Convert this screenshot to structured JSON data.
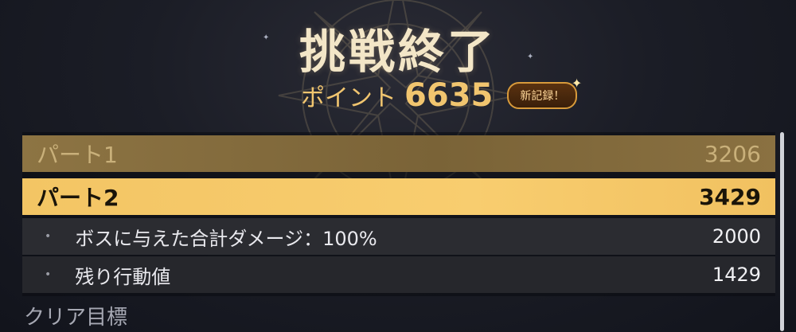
{
  "header": {
    "title": "挑戦終了",
    "points_label": "ポイント",
    "points_value": "6635",
    "new_record_badge": "新記録！"
  },
  "breakdown": {
    "part1": {
      "label": "パート1",
      "value": "3206"
    },
    "part2": {
      "label": "パート2",
      "value": "3429"
    },
    "sub_items": [
      {
        "bullet": "•",
        "label": "ボスに与えた合計ダメージ：100%",
        "value": "2000"
      },
      {
        "bullet": "•",
        "label": "残り行動値",
        "value": "1429"
      }
    ]
  },
  "section": {
    "clear_goal_label": "クリア目標"
  },
  "colors": {
    "gold_accent": "#f1c56f",
    "highlight_row": "#f8cd6f",
    "dim_row": "#8d7443",
    "background": "#1b1d26"
  }
}
